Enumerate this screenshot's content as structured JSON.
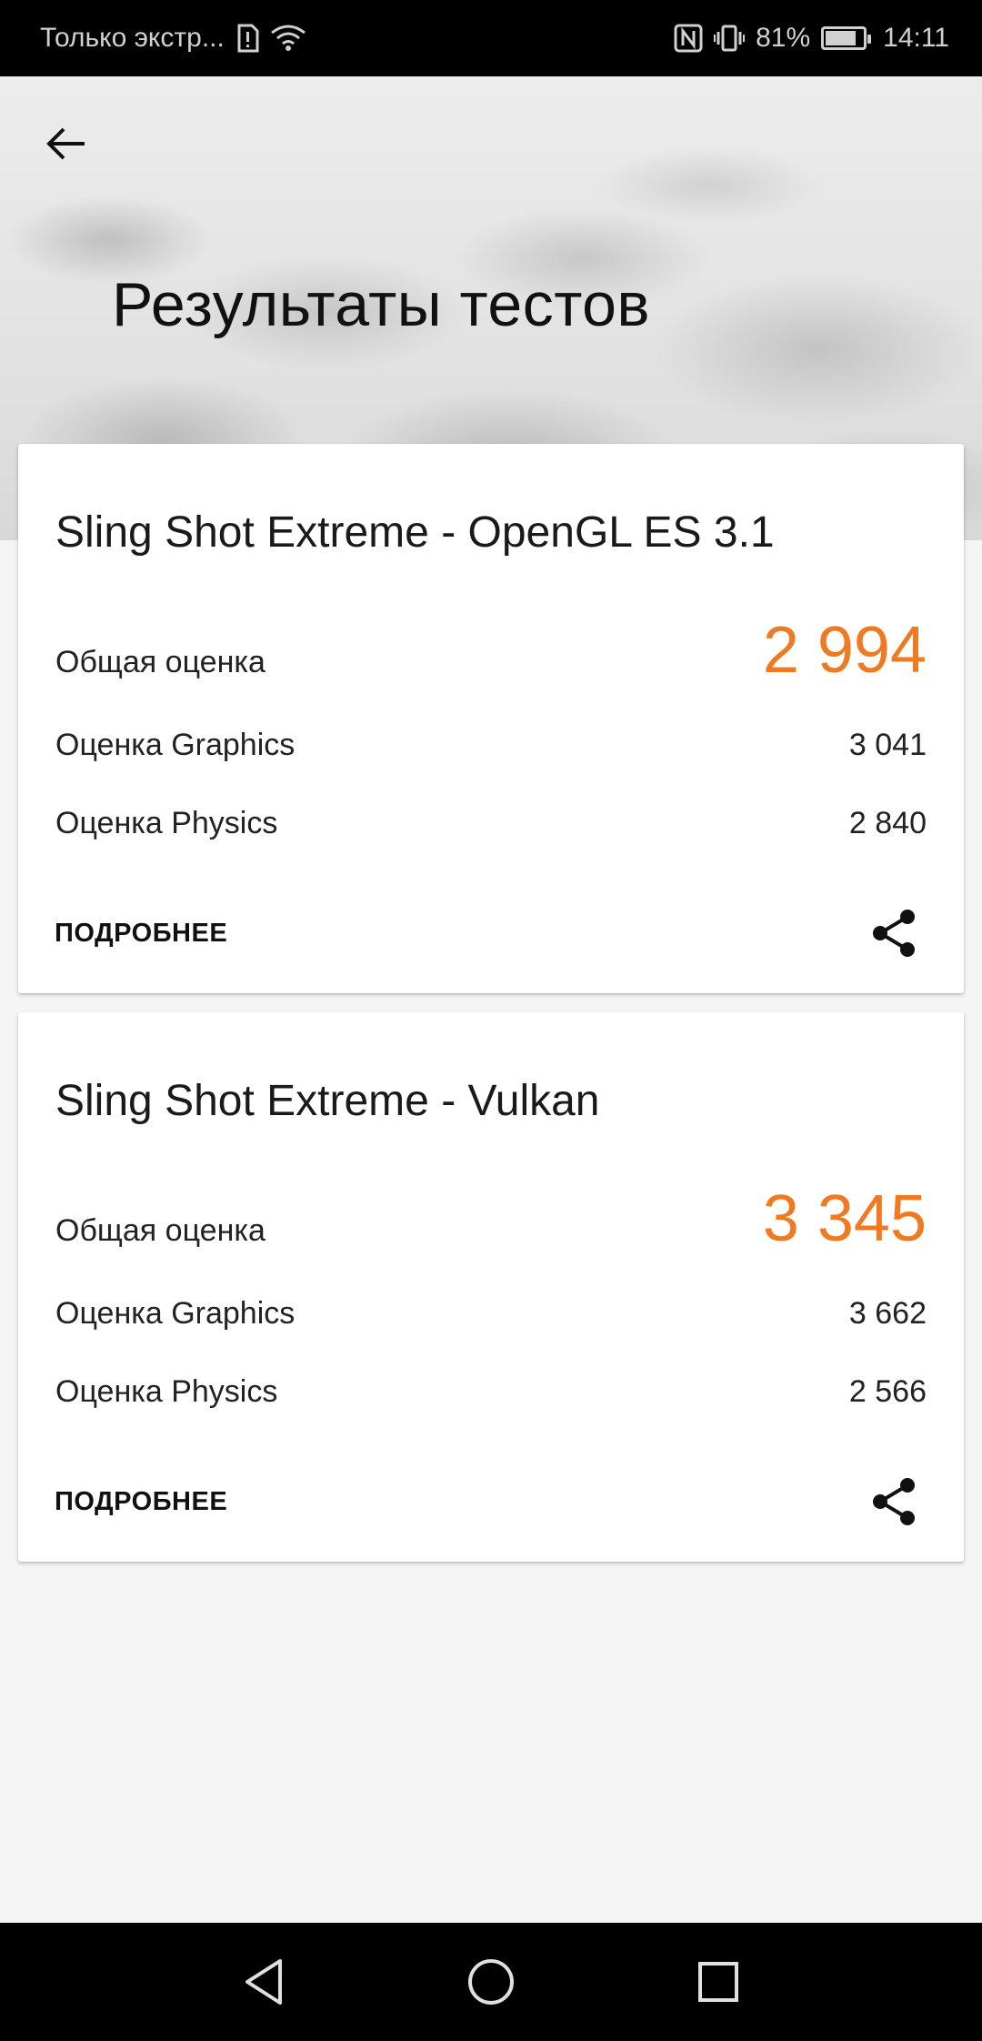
{
  "status_bar": {
    "carrier_text": "Только экстр...",
    "battery_percent": "81%",
    "battery_level": 0.81,
    "time": "14:11",
    "icons": [
      "alert-icon",
      "wifi-icon",
      "nfc-icon",
      "vibrate-icon",
      "battery-icon"
    ]
  },
  "header": {
    "back_icon": "arrow-left-icon",
    "title": "Результаты тестов"
  },
  "results": [
    {
      "title": "Sling Shot Extreme - OpenGL ES 3.1",
      "total_label": "Общая оценка",
      "total_value": "2 994",
      "graphics_label": "Оценка Graphics",
      "graphics_value": "3 041",
      "physics_label": "Оценка Physics",
      "physics_value": "2 840",
      "more_label": "ПОДРОБНЕЕ",
      "share_icon": "share-icon"
    },
    {
      "title": "Sling Shot Extreme - Vulkan",
      "total_label": "Общая оценка",
      "total_value": "3 345",
      "graphics_label": "Оценка Graphics",
      "graphics_value": "3 662",
      "physics_label": "Оценка Physics",
      "physics_value": "2 566",
      "more_label": "ПОДРОБНЕЕ",
      "share_icon": "share-icon"
    }
  ],
  "nav_bar": {
    "icons": [
      "back-triangle-icon",
      "home-circle-icon",
      "recents-square-icon"
    ]
  },
  "colors": {
    "accent": "#f07a22",
    "status_bar_bg": "#000000",
    "card_bg": "#ffffff",
    "page_bg": "#f5f5f5"
  }
}
